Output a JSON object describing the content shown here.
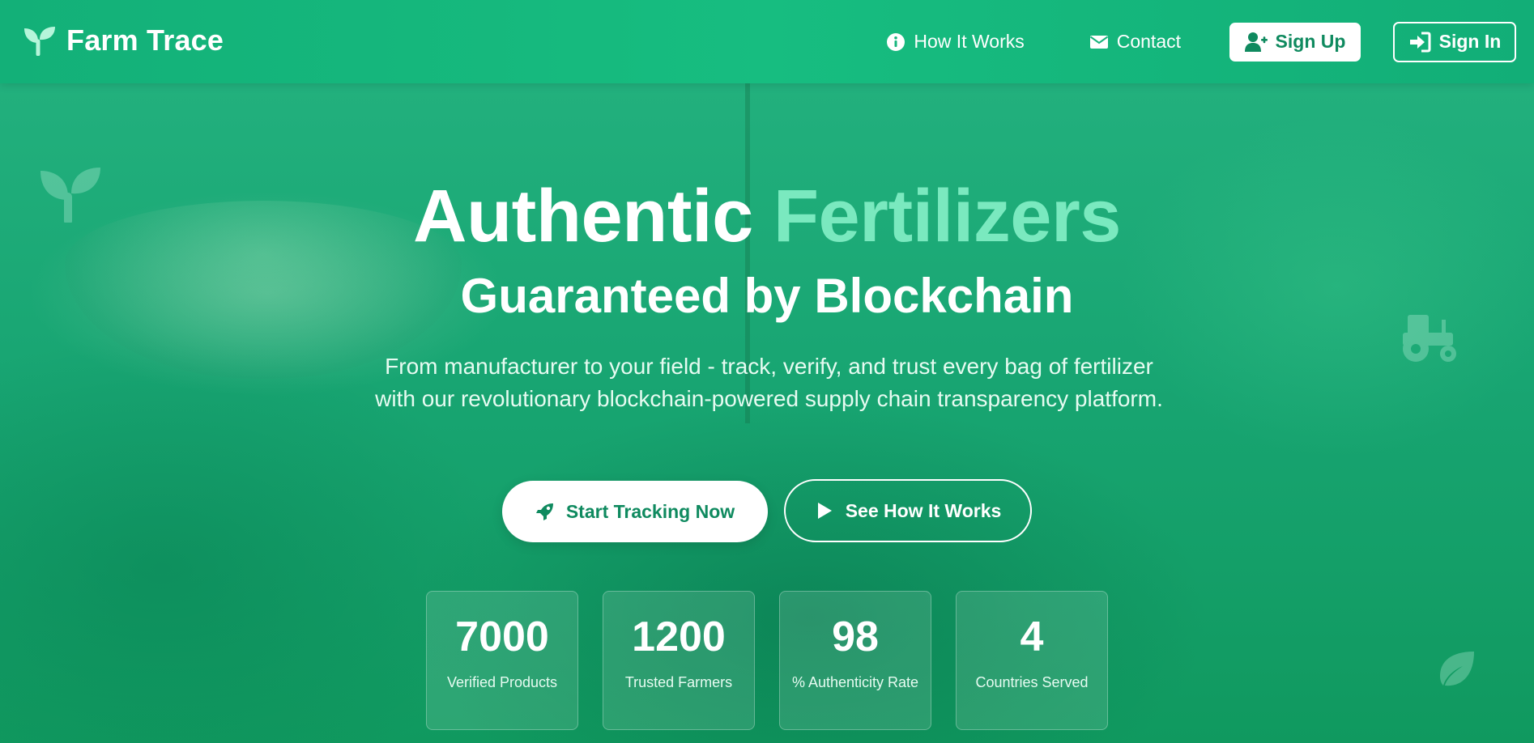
{
  "nav": {
    "brand": "Farm Trace",
    "links": [
      {
        "label": "How It Works",
        "icon": "info-icon"
      },
      {
        "label": "Contact",
        "icon": "envelope-icon"
      }
    ],
    "signup_label": "Sign Up",
    "signin_label": "Sign In"
  },
  "hero": {
    "title_main": "Authentic",
    "title_accent": "Fertilizers",
    "subtitle": "Guaranteed by Blockchain",
    "description": "From manufacturer to your field - track, verify, and trust every bag of fertilizer with our revolutionary blockchain-powered supply chain transparency platform.",
    "primary_cta": "Start Tracking Now",
    "secondary_cta": "See How It Works"
  },
  "stats": [
    {
      "value": "7000",
      "label": "Verified Products"
    },
    {
      "value": "1200",
      "label": "Trusted Farmers"
    },
    {
      "value": "98",
      "label": "% Authenticity Rate"
    },
    {
      "value": "4",
      "label": "Countries Served"
    }
  ],
  "colors": {
    "brand_green": "#17b57d",
    "accent_mint": "#7ae9bf",
    "button_text": "#0f8a5f"
  }
}
